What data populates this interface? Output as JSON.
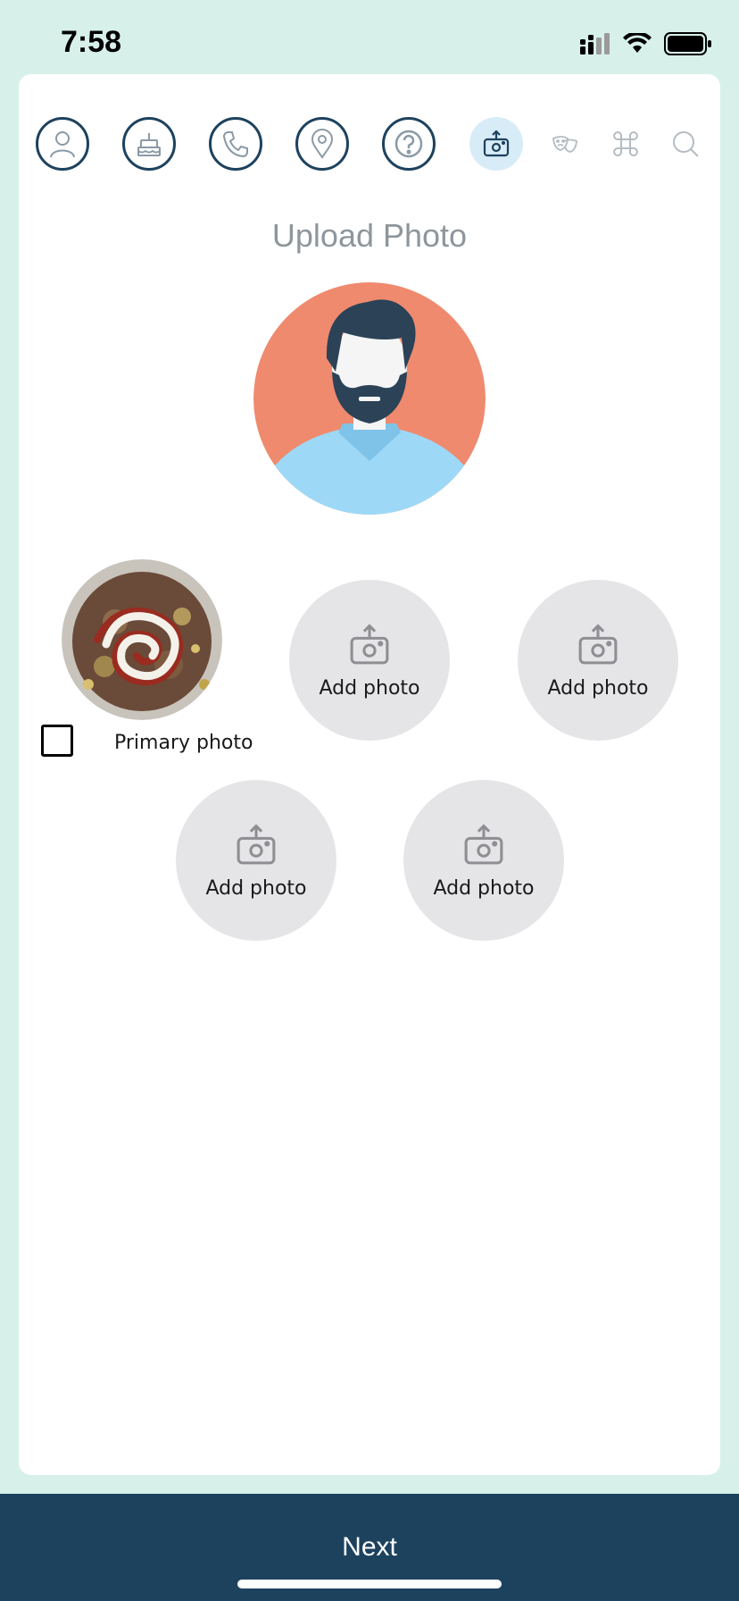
{
  "status_bar": {
    "time": "7:58"
  },
  "steps": [
    {
      "icon": "person-icon",
      "state": "done"
    },
    {
      "icon": "birthday-cake-icon",
      "state": "done"
    },
    {
      "icon": "phone-icon",
      "state": "done"
    },
    {
      "icon": "location-pin-icon",
      "state": "done"
    },
    {
      "icon": "question-icon",
      "state": "done"
    },
    {
      "icon": "camera-upload-icon",
      "state": "active"
    },
    {
      "icon": "theater-masks-icon",
      "state": "pending"
    },
    {
      "icon": "command-icon",
      "state": "pending"
    },
    {
      "icon": "search-icon",
      "state": "pending"
    }
  ],
  "page": {
    "title": "Upload Photo"
  },
  "photos": {
    "add_label": "Add photo",
    "primary_label": "Primary photo",
    "primary_checked": false,
    "slots": [
      {
        "label": "Add photo"
      },
      {
        "label": "Add photo"
      },
      {
        "label": "Add photo"
      },
      {
        "label": "Add photo"
      }
    ]
  },
  "footer": {
    "next_label": "Next"
  },
  "colors": {
    "background": "#d7f1ea",
    "navy": "#1d425e",
    "active_step_bg": "#d8ecf8",
    "slot_bg": "#e5e5e7",
    "avatar_bg": "#ef8a6f",
    "avatar_shirt": "#9ed8f7"
  }
}
